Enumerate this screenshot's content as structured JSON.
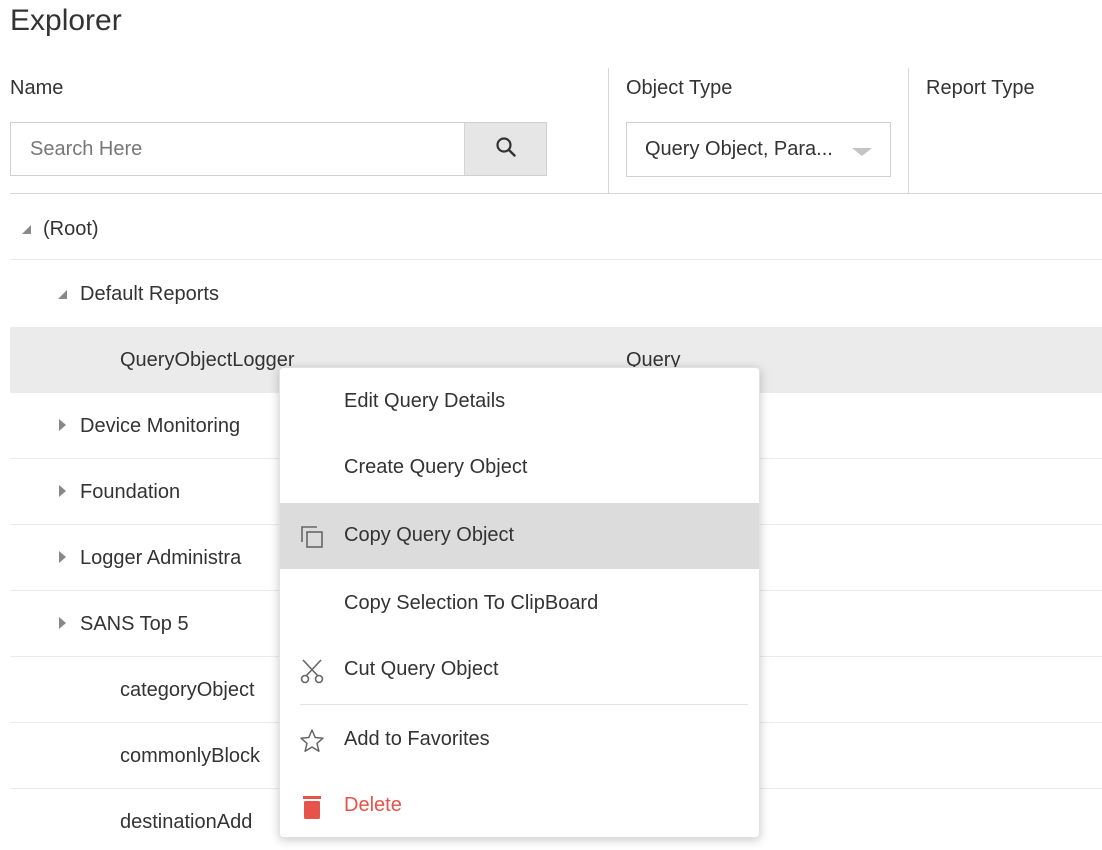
{
  "page": {
    "title": "Explorer"
  },
  "columns": {
    "name": "Name",
    "object_type": "Object Type",
    "report_type": "Report Type"
  },
  "search": {
    "placeholder": "Search Here",
    "value": ""
  },
  "object_type_select": {
    "value": "Query Object, Para..."
  },
  "tree": {
    "rows": [
      {
        "label": "(Root)",
        "state": "expanded",
        "depth": 0
      },
      {
        "label": "Default Reports",
        "state": "expanded",
        "depth": 1
      },
      {
        "label": "QueryObjectLogger",
        "object_type": "Query",
        "selected": true,
        "depth": 2
      },
      {
        "label": "Device Monitoring",
        "state": "collapsed",
        "depth": 1
      },
      {
        "label": "Foundation",
        "state": "collapsed",
        "depth": 1
      },
      {
        "label": "Logger Administra",
        "state": "collapsed",
        "depth": 1
      },
      {
        "label": "SANS Top 5",
        "state": "collapsed",
        "depth": 1
      },
      {
        "label": "categoryObject",
        "depth": 2
      },
      {
        "label": "commonlyBlock",
        "depth": 2
      },
      {
        "label": "destinationAdd",
        "depth": 2
      }
    ]
  },
  "context_menu": {
    "items": [
      {
        "label": "Edit Query Details",
        "icon": "none"
      },
      {
        "label": "Create Query Object",
        "icon": "none"
      },
      {
        "label": "Copy Query Object",
        "icon": "copy-icon",
        "highlighted": true
      },
      {
        "label": "Copy Selection To ClipBoard",
        "icon": "none"
      },
      {
        "label": "Cut Query Object",
        "icon": "scissors-icon"
      },
      {
        "label": "Add to Favorites",
        "icon": "star-icon"
      },
      {
        "label": "Delete",
        "icon": "trash-icon",
        "color": "#e5534b"
      }
    ]
  },
  "colors": {
    "selected_row": "#ebebeb",
    "menu_highlight": "#dcdcdc",
    "danger": "#e5534b"
  }
}
